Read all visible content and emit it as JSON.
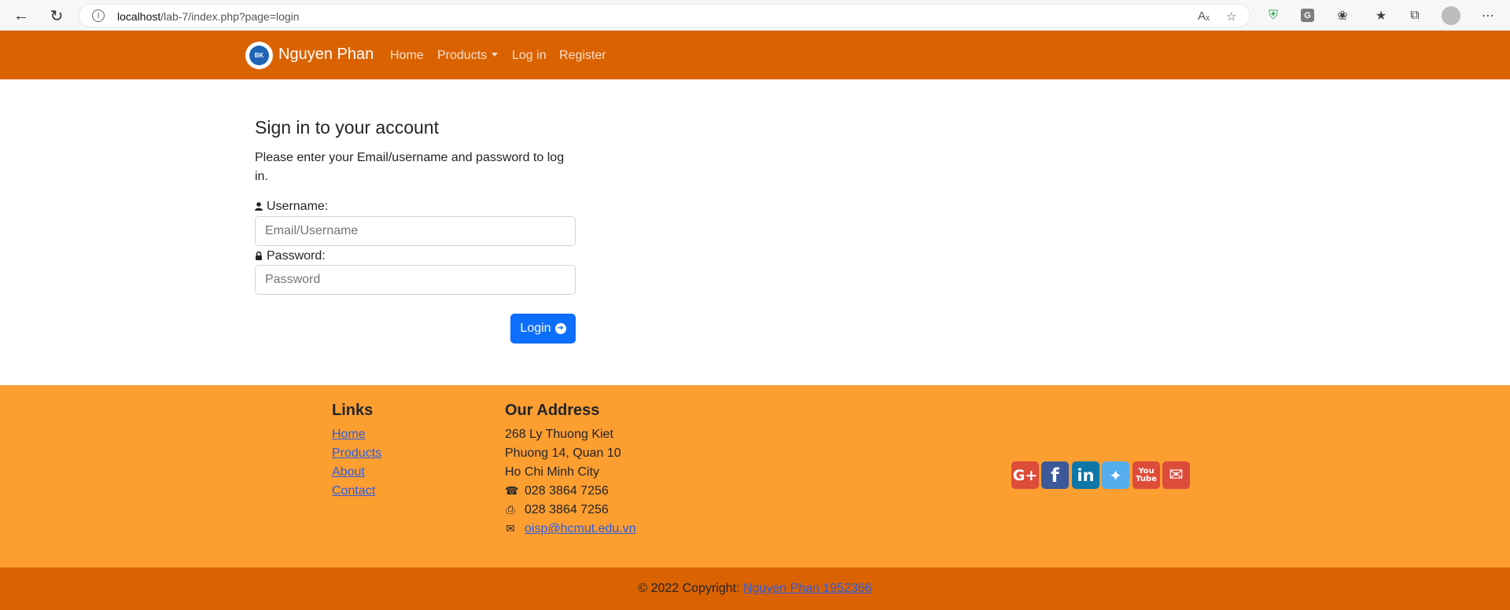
{
  "browser": {
    "url_host": "localhost",
    "url_path": "/lab-7/index.php?page=login"
  },
  "navbar": {
    "brand": "Nguyen Phan",
    "logo_text": "BK",
    "items": [
      "Home",
      "Products",
      "Log in",
      "Register"
    ]
  },
  "login": {
    "title": "Sign in to your account",
    "description": "Please enter your Email/username and password to log in.",
    "username_label": "Username:",
    "username_placeholder": "Email/Username",
    "password_label": "Password:",
    "password_placeholder": "Password",
    "button": "Login"
  },
  "footer": {
    "links_heading": "Links",
    "links": [
      "Home",
      "Products",
      "About",
      "Contact"
    ],
    "address_heading": "Our Address",
    "address_lines": [
      "268 Ly Thuong Kiet",
      "Phuong 14, Quan 10",
      "Ho Chi Minh City"
    ],
    "phone": "028 3864 7256",
    "fax": "028 3864 7256",
    "email": "oisp@hcmut.edu.vn",
    "social": [
      "google-plus",
      "facebook",
      "linkedin",
      "twitter",
      "youtube",
      "email"
    ],
    "youtube_label": "You Tube",
    "copyright_prefix": "© 2022 Copyright: ",
    "copyright_link": "Nguyen Phan 1952366"
  }
}
